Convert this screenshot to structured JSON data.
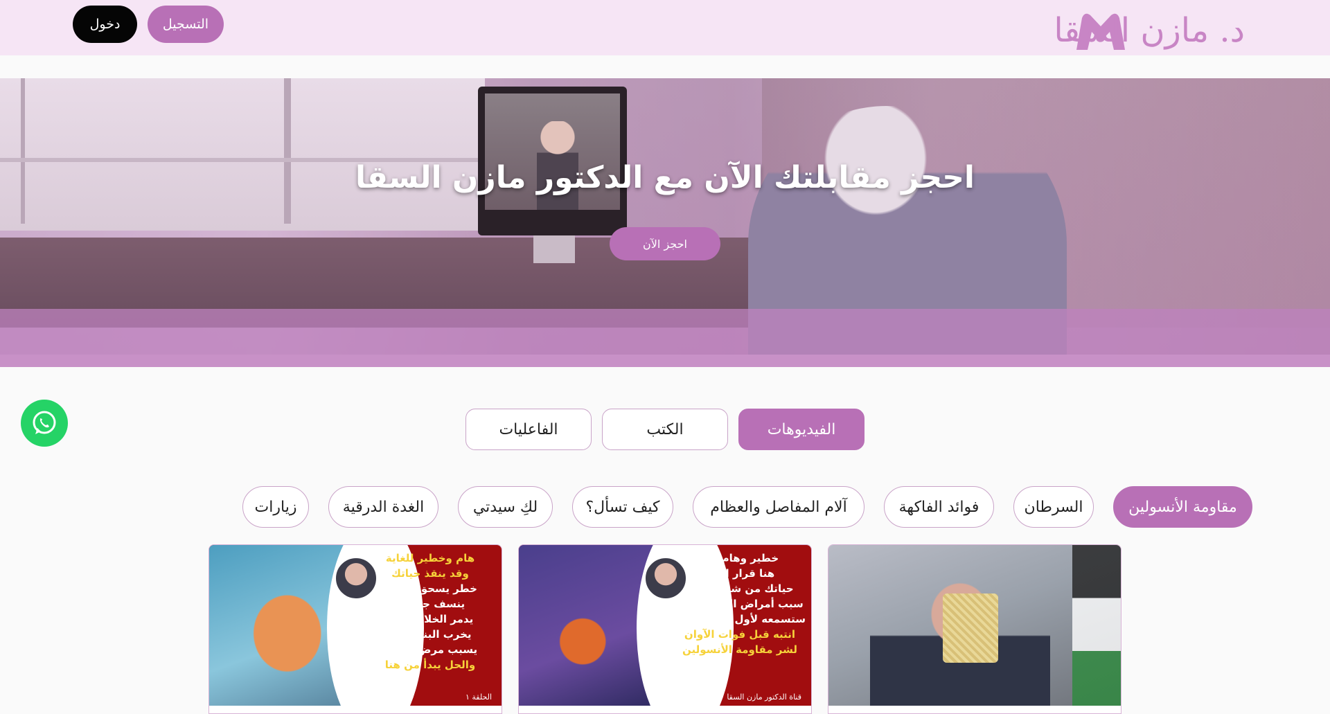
{
  "header": {
    "logo_text": "د. مازن السقا",
    "register_label": "التسجيل",
    "login_label": "دخول"
  },
  "hero": {
    "title": "احجز مقابلتك الآن مع الدكتور مازن السقا",
    "cta_label": "احجز الآن"
  },
  "tabs": [
    {
      "label": "الفيديوهات",
      "active": true
    },
    {
      "label": "الكتب",
      "active": false
    },
    {
      "label": "الفاعليات",
      "active": false
    }
  ],
  "categories": [
    {
      "label": "مقاومة الأنسولين",
      "active": true
    },
    {
      "label": "السرطان",
      "active": false
    },
    {
      "label": "فوائد الفاكهة",
      "active": false
    },
    {
      "label": "آلام المفاصل والعظام",
      "active": false
    },
    {
      "label": "كيف تسأل؟",
      "active": false
    },
    {
      "label": "لكِ سيدتي",
      "active": false
    },
    {
      "label": "الغدة الدرقية",
      "active": false
    },
    {
      "label": "زيارات",
      "active": false
    }
  ],
  "videos": [
    {
      "lines": []
    },
    {
      "lines": [
        "خطير وهام جدا",
        "هنا قرار انقاذ",
        "حياتك من شر المرض",
        "سبب أمراض العصر الأول",
        "ستسمعه لأول مرة في حياتك",
        "انتبه قبل فوات الآوان",
        "لشر مقاومة الأنسولين"
      ],
      "footer": "قناة الدكتور مازن السقا"
    },
    {
      "lines": [
        "هام وخطير للغاية",
        "وقد ينقذ حياتك",
        "خطر يسحق الصحة",
        "ينسف جسمك",
        "يدمر الخلايا الحية",
        "يخرب البنكرياس",
        "يسبب مرض السكر",
        "والحل يبدأ من هنا"
      ],
      "footer": "الحلقة ١"
    }
  ],
  "colors": {
    "accent": "#b870b6",
    "header_bg": "#f6e5f5",
    "whatsapp": "#25d366",
    "thumb_red": "#a10d0f",
    "thumb_yellow": "#f6d23a"
  }
}
